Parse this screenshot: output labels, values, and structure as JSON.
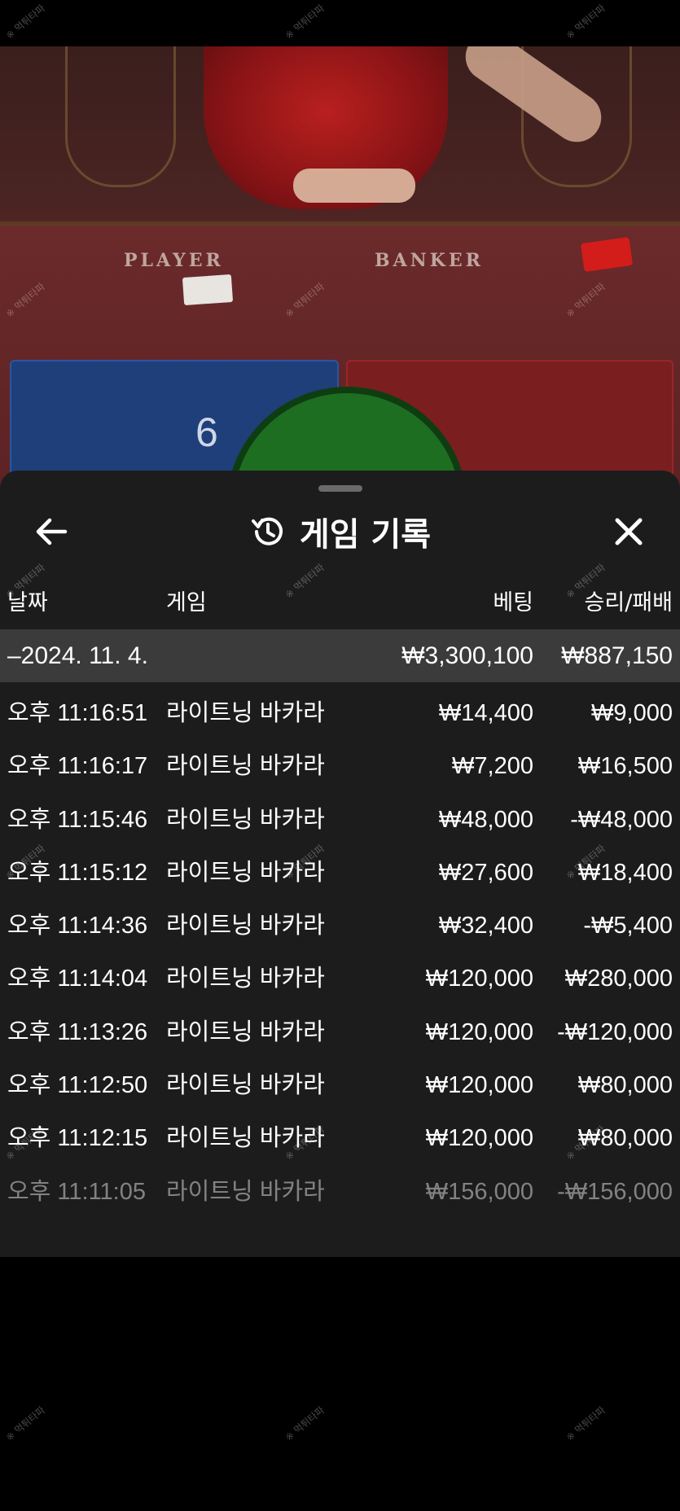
{
  "video": {
    "felt_player": "PLAYER",
    "felt_banker": "BANKER",
    "player_score": "6"
  },
  "watermark": "※ 먹튀타파",
  "sheet": {
    "title": "게임 기록",
    "icons": {
      "back": "arrow-left-icon",
      "history": "history-icon",
      "close": "close-icon"
    },
    "columns": {
      "date": "날짜",
      "game": "게임",
      "bet": "베팅",
      "win_loss": "승리/패배"
    },
    "group": {
      "label": "–2024. 11. 4.",
      "bet_total": "₩3,300,100",
      "win_total": "₩887,150"
    },
    "rows": [
      {
        "time": "오후 11:16:51",
        "game": "라이트닝 바카라",
        "bet": "₩14,400",
        "result": "₩9,000"
      },
      {
        "time": "오후 11:16:17",
        "game": "라이트닝 바카라",
        "bet": "₩7,200",
        "result": "₩16,500"
      },
      {
        "time": "오후 11:15:46",
        "game": "라이트닝 바카라",
        "bet": "₩48,000",
        "result": "-₩48,000"
      },
      {
        "time": "오후 11:15:12",
        "game": "라이트닝 바카라",
        "bet": "₩27,600",
        "result": "₩18,400"
      },
      {
        "time": "오후 11:14:36",
        "game": "라이트닝 바카라",
        "bet": "₩32,400",
        "result": "-₩5,400"
      },
      {
        "time": "오후 11:14:04",
        "game": "라이트닝 바카라",
        "bet": "₩120,000",
        "result": "₩280,000"
      },
      {
        "time": "오후 11:13:26",
        "game": "라이트닝 바카라",
        "bet": "₩120,000",
        "result": "-₩120,000"
      },
      {
        "time": "오후 11:12:50",
        "game": "라이트닝 바카라",
        "bet": "₩120,000",
        "result": "₩80,000"
      },
      {
        "time": "오후 11:12:15",
        "game": "라이트닝 바카라",
        "bet": "₩120,000",
        "result": "₩80,000"
      },
      {
        "time": "오후 11:11:05",
        "game": "라이트닝 바카라",
        "bet": "₩156,000",
        "result": "-₩156,000"
      }
    ]
  }
}
